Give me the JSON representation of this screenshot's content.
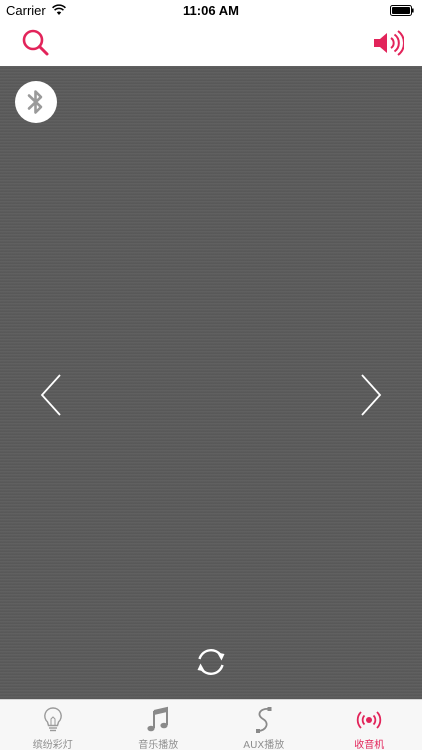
{
  "status_bar": {
    "carrier": "Carrier",
    "time": "11:06 AM"
  },
  "nav": {
    "left_icon": "search-icon",
    "right_icon": "speaker-volume-icon",
    "accent_color": "#e2245a"
  },
  "main": {
    "background_color": "#5a5a5a",
    "bluetooth_icon": "bluetooth-icon",
    "prev_icon": "chevron-left-icon",
    "next_icon": "chevron-right-icon",
    "refresh_icon": "refresh-icon"
  },
  "tabs": [
    {
      "label": "缤纷彩灯",
      "icon": "lightbulb-icon",
      "active": false
    },
    {
      "label": "音乐播放",
      "icon": "music-note-icon",
      "active": false
    },
    {
      "label": "AUX播放",
      "icon": "aux-cable-icon",
      "active": false
    },
    {
      "label": "收音机",
      "icon": "radio-waves-icon",
      "active": true
    }
  ]
}
